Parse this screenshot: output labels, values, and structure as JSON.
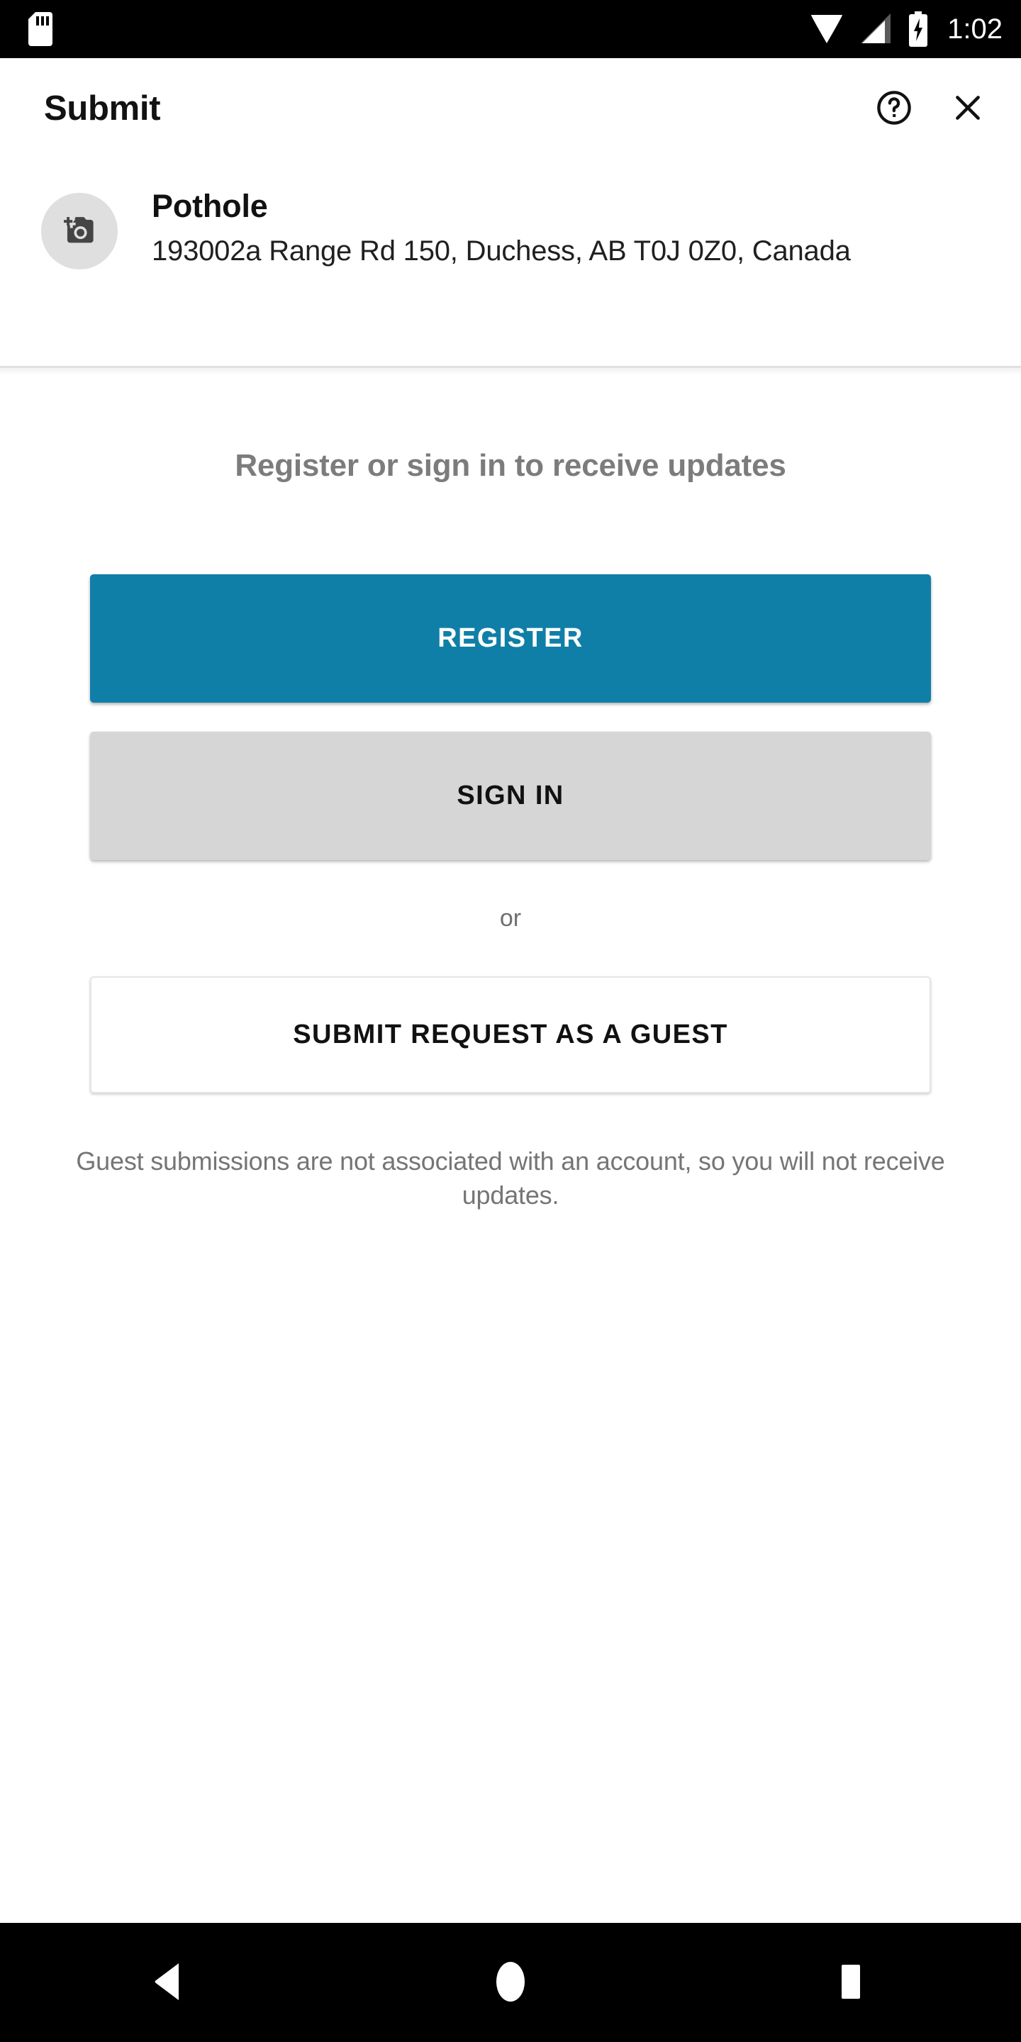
{
  "status_bar": {
    "time": "1:02",
    "icons": {
      "storage": "sd-card-icon",
      "wifi": "wifi-icon",
      "signal": "cellular-signal-icon",
      "battery": "battery-charging-icon"
    },
    "background_color": "#000000",
    "foreground_color": "#ffffff"
  },
  "app_bar": {
    "title": "Submit",
    "help_label": "help-circle-icon",
    "close_label": "close-icon"
  },
  "item": {
    "avatar_icon": "add-a-photo-icon",
    "avatar_background": "#dfdfdf",
    "title": "Pothole",
    "address": "193002a Range Rd 150, Duchess, AB T0J 0Z0, Canada"
  },
  "main": {
    "prompt": "Register or sign in to receive updates",
    "register_button": "REGISTER",
    "sign_in_button": "SIGN IN",
    "or_divider": "or",
    "guest_button": "SUBMIT REQUEST AS A GUEST",
    "guest_note": "Guest submissions are not associated with an account, so you will not receive updates."
  },
  "colors": {
    "accent": "#0f7fa8",
    "secondary_button": "#d6d6d6",
    "muted_text": "#757575",
    "prompt_text": "#7c7c7c",
    "page_background": "#ffffff"
  },
  "nav_bar": {
    "back": "back-triangle-icon",
    "home": "home-circle-icon",
    "recents": "recents-square-icon",
    "background_color": "#000000"
  }
}
